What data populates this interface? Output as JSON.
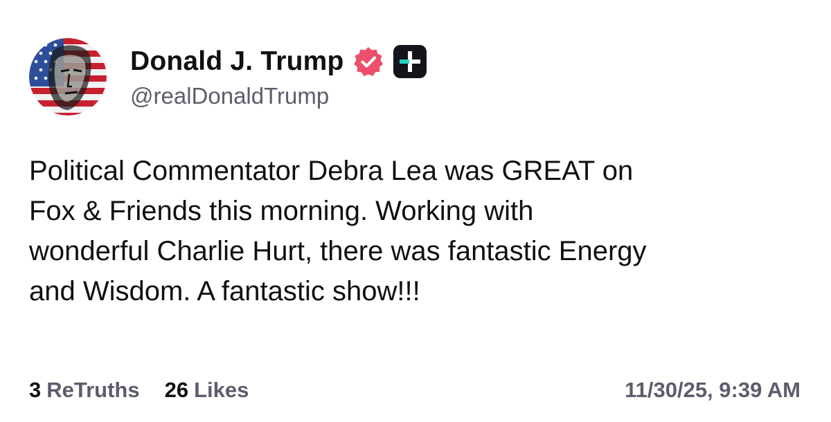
{
  "author": {
    "display_name": "Donald J. Trump",
    "handle": "@realDonaldTrump",
    "avatar_icon": "flag-portrait-avatar",
    "verified_icon": "verified-badge-icon",
    "verified_color": "#ec4f6b",
    "plus_icon": "truth-plus-icon",
    "plus_color": "#22d3c5"
  },
  "post": {
    "lines": [
      "Political Commentator Debra Lea was GREAT on",
      "Fox & Friends this morning. Working with",
      "wonderful Charlie Hurt, there was fantastic Energy",
      "and Wisdom. A fantastic show!!!"
    ]
  },
  "stats": {
    "retruths_count": "3",
    "retruths_label": "ReTruths",
    "likes_count": "26",
    "likes_label": "Likes"
  },
  "timestamp": "11/30/25, 9:39 AM"
}
